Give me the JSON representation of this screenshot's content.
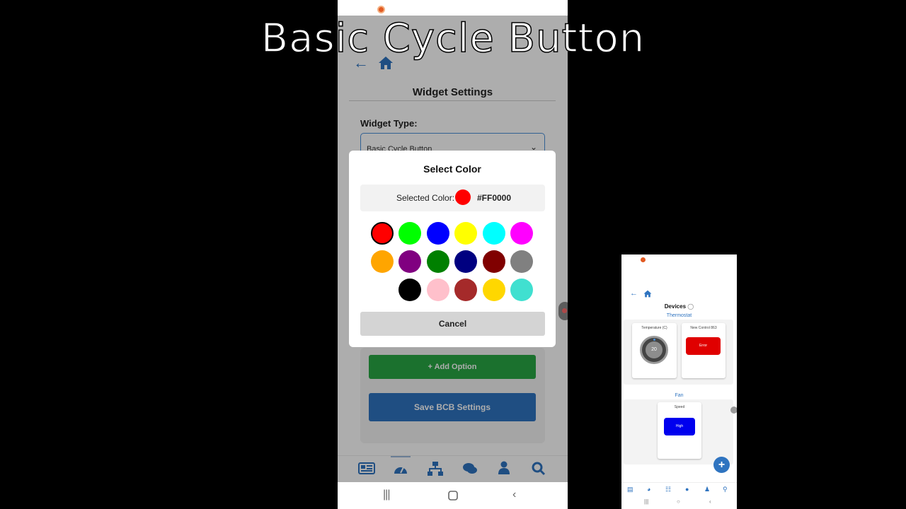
{
  "video_title": "Basic Cycle Button",
  "main_phone": {
    "nav": {
      "back_icon": "arrow-left-icon",
      "home_icon": "home-icon"
    },
    "page_title": "Widget Settings",
    "widget_type_label": "Widget Type:",
    "widget_type_value": "Basic Cycle Button",
    "add_option_label": "+ Add Option",
    "save_label": "Save BCB Settings",
    "colors": {
      "accent": "#2F74C0",
      "green": "#28A745"
    },
    "tabs": [
      {
        "icon": "newspaper-icon"
      },
      {
        "icon": "dashboard-icon"
      },
      {
        "icon": "sitemap-icon"
      },
      {
        "icon": "chat-icon"
      },
      {
        "icon": "user-icon"
      },
      {
        "icon": "search-icon"
      }
    ],
    "dialog": {
      "title": "Select Color",
      "selected_label": "Selected Color:",
      "selected_hex": "#FF0000",
      "selected_color": "#FF0000",
      "swatches": [
        "#FF0000",
        "#00FF00",
        "#0000FF",
        "#FFFF00",
        "#00FFFF",
        "#FF00FF",
        "#FFA500",
        "#800080",
        "#008000",
        "#000080",
        "#800000",
        "#808080",
        "#FFFFFF",
        "#000000",
        "#FFC0CB",
        "#A52A2A",
        "#FFD700",
        "#40E0D0"
      ],
      "cancel_label": "Cancel"
    }
  },
  "mini_phone": {
    "page_title": "Devices",
    "sections": [
      {
        "name": "Thermostat",
        "cards": [
          {
            "label": "Temperature (C)",
            "value": "20"
          },
          {
            "label": "New Control 863",
            "button": "Error",
            "button_color": "#E00000"
          }
        ]
      },
      {
        "name": "Fan",
        "cards": [
          {
            "label": "Speed",
            "button": "High",
            "button_color": "#0000EE"
          }
        ]
      }
    ]
  }
}
